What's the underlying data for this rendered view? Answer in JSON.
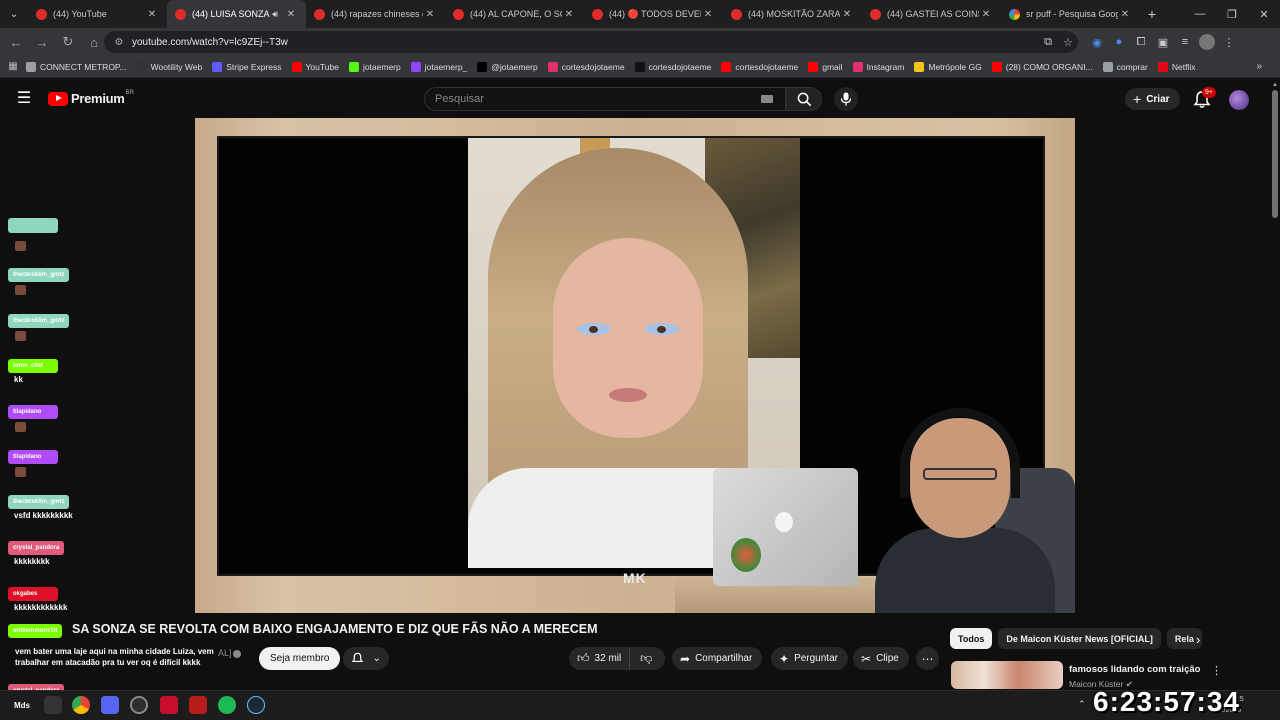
{
  "browser": {
    "tabs": [
      {
        "title": "(44) YouTube",
        "active": false,
        "favicon": "youtube-icon"
      },
      {
        "title": "(44) LUISA SONZA SE",
        "active": true,
        "favicon": "youtube-icon",
        "audio": true
      },
      {
        "title": "(44) rapazes chineses cob",
        "active": false,
        "favicon": "youtube-icon"
      },
      {
        "title": "(44) AL CAPONE, O SCAR",
        "active": false,
        "favicon": "youtube-icon"
      },
      {
        "title": "(44) 🔴 TODOS DEVEM R",
        "active": false,
        "favicon": "youtube-icon"
      },
      {
        "title": "(44) MOSKITÃO ZARALHA",
        "active": false,
        "favicon": "youtube-icon"
      },
      {
        "title": "(44) GASTEI AS COINS DO",
        "active": false,
        "favicon": "youtube-icon"
      },
      {
        "title": "sr puff - Pesquisa Google",
        "active": false,
        "favicon": "google-icon"
      }
    ],
    "url": "youtube.com/watch?v=lc9ZEj--T3w",
    "bookmarks": [
      {
        "label": "CONNECT METROP...",
        "color": "#9aa0a6"
      },
      {
        "label": "Wootility Web",
        "color": "#333333"
      },
      {
        "label": "Stripe Express",
        "color": "#635bff"
      },
      {
        "label": "YouTube",
        "color": "#ff0000"
      },
      {
        "label": "jotaemerp",
        "color": "#53fc18"
      },
      {
        "label": "jotaemerp_",
        "color": "#9146ff"
      },
      {
        "label": "@jotaemerp",
        "color": "#000000"
      },
      {
        "label": "cortesdojotaeme",
        "color": "#e1306c"
      },
      {
        "label": "cortesdojotaeme",
        "color": "#111111"
      },
      {
        "label": "cortesdojotaeme",
        "color": "#ff0000"
      },
      {
        "label": "gmail",
        "color": "#ff0000"
      },
      {
        "label": "Instagram",
        "color": "#e1306c"
      },
      {
        "label": "Metrópole GG",
        "color": "#f5c518"
      },
      {
        "label": "(28) COMO ORGANI...",
        "color": "#ff0000"
      },
      {
        "label": "comprar",
        "color": "#9aa0a6"
      },
      {
        "label": "Netflix",
        "color": "#e50914"
      }
    ]
  },
  "youtube": {
    "logo_text": "Premium",
    "logo_region": "BR",
    "search_placeholder": "Pesquisar",
    "create_label": "Criar",
    "notif_badge": "9+"
  },
  "video": {
    "watermark": "MK",
    "title": "SA SONZA SE REVOLTA COM BAIXO ENGAJAMENTO E DIZ QUE FÃS NÃO A MERECEM",
    "channel_fragment": "AL]",
    "member_label": "Seja membro",
    "likes": "32 mil",
    "share_label": "Compartilhar",
    "ask_label": "Perguntar",
    "clip_label": "Clipe"
  },
  "chat": [
    {
      "user": "",
      "msg": "",
      "emote": true,
      "color": "#8fd6c0"
    },
    {
      "user": "thecbroklim_gmtz",
      "msg": "",
      "emote": true,
      "color": "#8fd6c0"
    },
    {
      "user": "thecbroklim_gmtz",
      "msg": "",
      "emote": true,
      "color": "#8fd6c0"
    },
    {
      "user": "tomo_cllst",
      "msg": "kk",
      "emote": false,
      "color": "#7cfc00"
    },
    {
      "user": "tilapidano",
      "msg": "",
      "emote": true,
      "color": "#b04cf5"
    },
    {
      "user": "tilapidano",
      "msg": "",
      "emote": true,
      "color": "#b04cf5"
    },
    {
      "user": "thecbroklim_gmtz",
      "msg": "vsfd kkkkkkkkk",
      "emote": false,
      "color": "#8fd6c0"
    },
    {
      "user": "crystal_pandora",
      "msg": "kkkkkkkk",
      "emote": false,
      "color": "#e05a7a"
    },
    {
      "user": "okgabes",
      "msg": "kkkkkkkkkkkk",
      "emote": false,
      "color": "#e0102a"
    }
  ],
  "chat_bottom": {
    "user": "mtitlemmorrr1lt",
    "msg": "vem bater uma laje aqui na minha cidade Luiza, vem trabalhar em atacadão pra tu ver oq é difícil kkkk",
    "color": "#7cfc00",
    "user2": "crystal_pandora",
    "color2": "#e05a7a"
  },
  "sidebar": {
    "chips": [
      "Todos",
      "De Maicon Küster News [OFICIAL]",
      "Rela"
    ],
    "rec_title": "famosos lidando com traição",
    "rec_channel": "Maicon Küster"
  },
  "taskbar": {
    "label": "Mds",
    "clock": "6:23:57:34",
    "tray_time": "10:5",
    "tray_date": "5/01/2025"
  }
}
